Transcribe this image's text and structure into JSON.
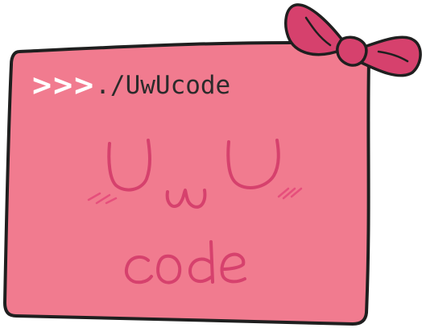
{
  "prompt": {
    "arrows": ">>>",
    "path": "./UwUcode"
  },
  "face_text": "UwU",
  "wordmark": "code",
  "colors": {
    "card_fill": "#f17b8f",
    "card_outline": "#1f1f1f",
    "bow_fill": "#d6416d",
    "ink": "#d6416d",
    "blush": "#e64f7c",
    "prompt_arrows": "#ffffff",
    "prompt_text": "#2b2b2b"
  },
  "icons": [
    "bow-icon",
    "blush-marks-icon"
  ]
}
